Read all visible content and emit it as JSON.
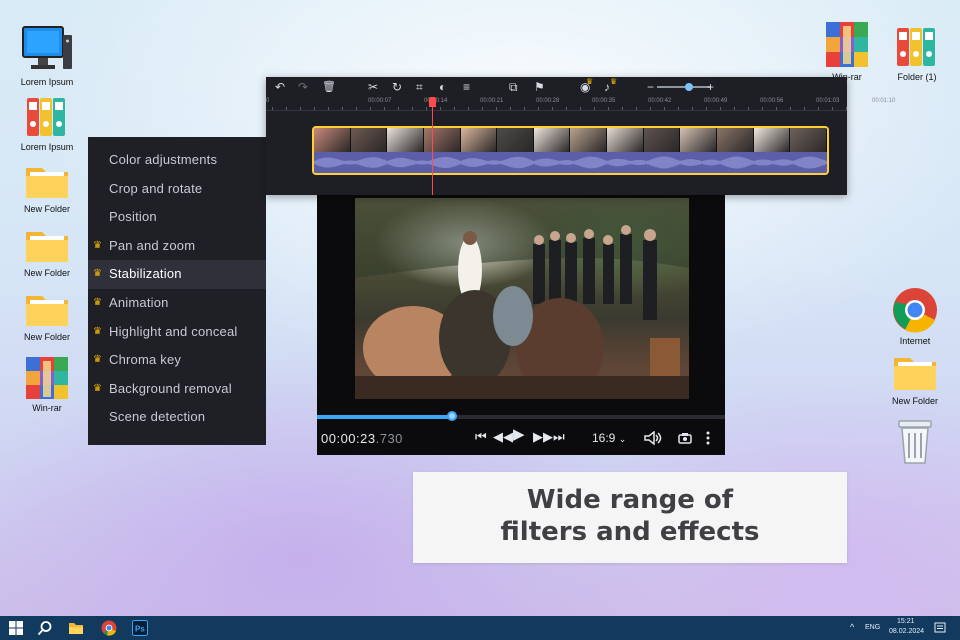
{
  "desktop": {
    "left_icons": [
      {
        "label": "Lorem Ipsum",
        "icon": "computer-icon"
      },
      {
        "label": "Lorem Ipsum",
        "icon": "binders-icon"
      },
      {
        "label": "New Folder",
        "icon": "folder-icon"
      },
      {
        "label": "New Folder",
        "icon": "folder-icon"
      },
      {
        "label": "New Folder",
        "icon": "folder-icon"
      },
      {
        "label": "Win-rar",
        "icon": "winrar-icon"
      }
    ],
    "top_right_icons": [
      {
        "label": "Win-rar",
        "icon": "winrar-icon"
      },
      {
        "label": "Folder (1)",
        "icon": "binders-icon"
      }
    ],
    "right_icons": [
      {
        "label": "Internet",
        "icon": "chrome-icon"
      },
      {
        "label": "New Folder",
        "icon": "folder-icon"
      },
      {
        "label": "",
        "icon": "recycle-bin-icon"
      }
    ]
  },
  "timeline": {
    "ruler_ticks": [
      "0",
      "00:00:07",
      "00:00:14",
      "00:00:21",
      "00:00:28",
      "00:00:35",
      "00:00:42",
      "00:00:49",
      "00:00:56",
      "00:01:03",
      "00:01:10"
    ],
    "toolbar_icons": [
      "undo-icon",
      "redo-icon",
      "delete-icon",
      "cut-icon",
      "rotate-icon",
      "crop-icon",
      "color-icon",
      "settings-icon",
      "overlay-icon",
      "flag-icon",
      "record-icon",
      "voice-icon",
      "zoom-out-icon",
      "zoom-in-icon"
    ],
    "zoom_level": 0.6
  },
  "filter_menu": {
    "items": [
      {
        "label": "Color adjustments",
        "premium": false,
        "active": false
      },
      {
        "label": "Crop and rotate",
        "premium": false,
        "active": false
      },
      {
        "label": "Position",
        "premium": false,
        "active": false
      },
      {
        "label": "Pan and zoom",
        "premium": true,
        "active": false
      },
      {
        "label": "Stabilization",
        "premium": true,
        "active": true
      },
      {
        "label": "Animation",
        "premium": true,
        "active": false
      },
      {
        "label": "Highlight and conceal",
        "premium": true,
        "active": false
      },
      {
        "label": "Chroma key",
        "premium": true,
        "active": false
      },
      {
        "label": "Background removal",
        "premium": true,
        "active": false
      },
      {
        "label": "Scene detection",
        "premium": false,
        "active": false
      }
    ]
  },
  "player": {
    "timecode_main": "00:00:23",
    "timecode_ms": ".730",
    "progress": 0.33,
    "aspect_ratio": "16:9",
    "accent": "#3ba6ff"
  },
  "caption": {
    "line1": "Wide range of",
    "line2": "filters and effects"
  },
  "taskbar": {
    "language": "ENG",
    "time": "15:21",
    "date": "08.02.2024",
    "apps": [
      "windows-start-icon",
      "search-icon",
      "file-explorer-icon",
      "chrome-icon",
      "photoshop-icon"
    ]
  }
}
